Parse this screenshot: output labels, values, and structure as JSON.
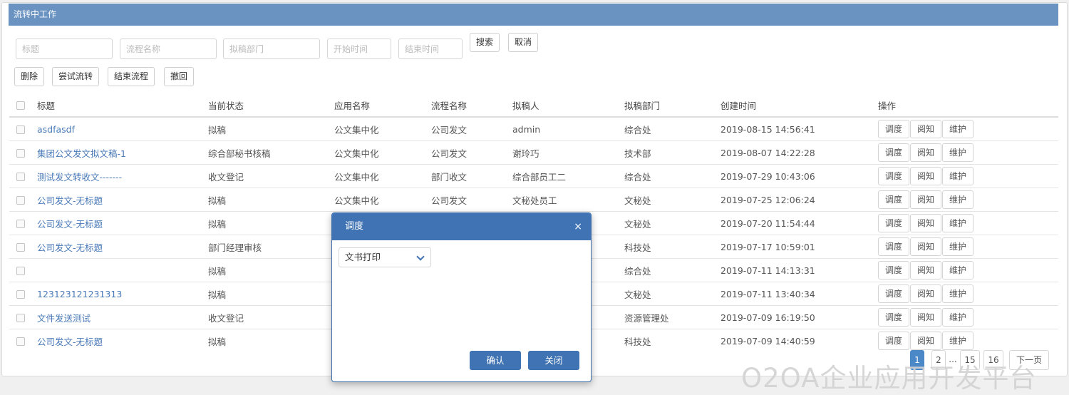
{
  "panel": {
    "title": "流转中工作"
  },
  "filters": {
    "title_placeholder": "标题",
    "process_placeholder": "流程名称",
    "dept_placeholder": "拟稿部门",
    "start_placeholder": "开始时间",
    "end_placeholder": "结束时间",
    "search_label": "搜索",
    "cancel_label": "取消"
  },
  "toolbar": {
    "delete_label": "删除",
    "try_flow_label": "尝试流转",
    "end_flow_label": "结束流程",
    "revoke_label": "撤回"
  },
  "table": {
    "columns": [
      "标题",
      "当前状态",
      "应用名称",
      "流程名称",
      "拟稿人",
      "拟稿部门",
      "创建时间",
      "操作"
    ],
    "op_labels": [
      "调度",
      "阅知",
      "维护"
    ],
    "rows": [
      {
        "title": "asdfasdf",
        "status": "拟稿",
        "app": "公文集中化",
        "process": "公司发文",
        "drafter": "admin",
        "dept": "综合处",
        "created": "2019-08-15 14:56:41"
      },
      {
        "title": "集团公文发文拟文稿-1",
        "status": "综合部秘书核稿",
        "app": "公文集中化",
        "process": "公司发文",
        "drafter": "谢玲巧",
        "dept": "技术部",
        "created": "2019-08-07 14:22:28"
      },
      {
        "title": "测试发文转收文-------",
        "status": "收文登记",
        "app": "公文集中化",
        "process": "部门收文",
        "drafter": "综合部员工二",
        "dept": "综合处",
        "created": "2019-07-29 10:43:06"
      },
      {
        "title": "公司发文-无标题",
        "status": "拟稿",
        "app": "公文集中化",
        "process": "公司发文",
        "drafter": "文秘处员工",
        "dept": "文秘处",
        "created": "2019-07-25 12:06:24"
      },
      {
        "title": "公司发文-无标题",
        "status": "拟稿",
        "app": "",
        "process": "",
        "drafter": "",
        "dept": "文秘处",
        "created": "2019-07-20 11:54:44"
      },
      {
        "title": "公司发文-无标题",
        "status": "部门经理审核",
        "app": "",
        "process": "",
        "drafter": "",
        "dept": "科技处",
        "created": "2019-07-17 10:59:01"
      },
      {
        "title": "",
        "status": "拟稿",
        "app": "",
        "process": "",
        "drafter": "",
        "dept": "综合处",
        "created": "2019-07-11 14:13:31"
      },
      {
        "title": "123123121231313",
        "status": "拟稿",
        "app": "",
        "process": "",
        "drafter": "",
        "dept": "文秘处",
        "created": "2019-07-11 13:40:34"
      },
      {
        "title": "文件发送测试",
        "status": "收文登记",
        "app": "",
        "process": "",
        "drafter": "",
        "dept": "资源管理处",
        "created": "2019-07-09 16:19:50"
      },
      {
        "title": "公司发文-无标题",
        "status": "拟稿",
        "app": "",
        "process": "",
        "drafter": "",
        "dept": "科技处",
        "created": "2019-07-09 14:40:59"
      }
    ]
  },
  "pager": {
    "pages": [
      "1",
      "2",
      "...",
      "15",
      "16"
    ],
    "next_label": "下一页",
    "current": "1"
  },
  "dialog": {
    "title": "调度",
    "close_glyph": "×",
    "select_value": "文书打印",
    "confirm_label": "确认",
    "close_label": "关闭"
  },
  "watermark": "O2OA企业应用开发平台",
  "colors": {
    "header": "#6a93c2",
    "dialog_header": "#3f73b3",
    "link": "#4a7ab8",
    "active_page": "#4a88c7"
  }
}
